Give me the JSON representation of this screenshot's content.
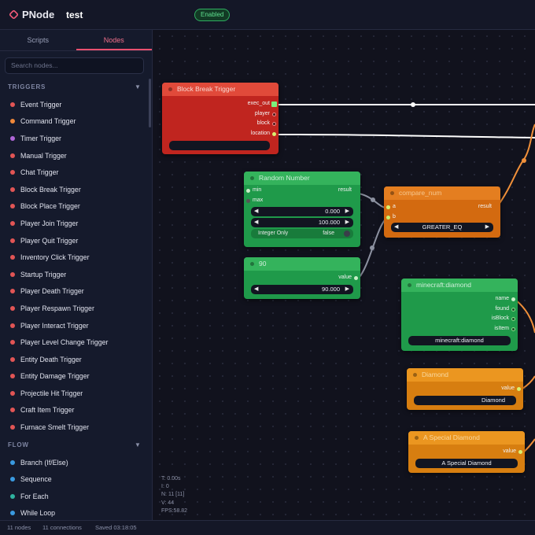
{
  "app": {
    "logo_text": "PNode",
    "project_title": "test",
    "status_badge": "Enabled"
  },
  "sidebar": {
    "tabs": [
      {
        "label": "Scripts"
      },
      {
        "label": "Nodes"
      }
    ],
    "search_placeholder": "Search nodes...",
    "categories": [
      {
        "label": "TRIGGERS",
        "chevron": "▼",
        "items": [
          {
            "label": "Event Trigger",
            "color": "#e25555"
          },
          {
            "label": "Command Trigger",
            "color": "#f0883a"
          },
          {
            "label": "Timer Trigger",
            "color": "#b066d8"
          },
          {
            "label": "Manual Trigger",
            "color": "#e25555"
          },
          {
            "label": "Chat Trigger",
            "color": "#e25555"
          },
          {
            "label": "Block Break Trigger",
            "color": "#e25555"
          },
          {
            "label": "Block Place Trigger",
            "color": "#e25555"
          },
          {
            "label": "Player Join Trigger",
            "color": "#e25555"
          },
          {
            "label": "Player Quit Trigger",
            "color": "#e25555"
          },
          {
            "label": "Inventory Click Trigger",
            "color": "#e25555"
          },
          {
            "label": "Startup Trigger",
            "color": "#e25555"
          },
          {
            "label": "Player Death Trigger",
            "color": "#e25555"
          },
          {
            "label": "Player Respawn Trigger",
            "color": "#e25555"
          },
          {
            "label": "Player Interact Trigger",
            "color": "#e25555"
          },
          {
            "label": "Player Level Change Trigger",
            "color": "#e25555"
          },
          {
            "label": "Entity Death Trigger",
            "color": "#e25555"
          },
          {
            "label": "Entity Damage Trigger",
            "color": "#e25555"
          },
          {
            "label": "Projectile Hit Trigger",
            "color": "#e25555"
          },
          {
            "label": "Craft Item Trigger",
            "color": "#e25555"
          },
          {
            "label": "Furnace Smelt Trigger",
            "color": "#e25555"
          }
        ]
      },
      {
        "label": "FLOW",
        "chevron": "▼",
        "items": [
          {
            "label": "Branch (If/Else)",
            "color": "#3a9ae0"
          },
          {
            "label": "Sequence",
            "color": "#3a9ae0"
          },
          {
            "label": "For Each",
            "color": "#2fb3a0"
          },
          {
            "label": "While Loop",
            "color": "#3a9ae0"
          }
        ]
      }
    ]
  },
  "nodes": {
    "block_break": {
      "title": "Block Break Trigger",
      "outputs": [
        "exec_out",
        "player",
        "block",
        "location"
      ],
      "field_value": ""
    },
    "random_number": {
      "title": "Random Number",
      "inputs": [
        "min",
        "max"
      ],
      "output": "result",
      "min_value": "0.000",
      "max_value": "100.000",
      "toggle_label": "Integer Only",
      "toggle_value": "false"
    },
    "number_90": {
      "title": "90",
      "output": "value",
      "value": "90.000"
    },
    "compare": {
      "title": "compare_num",
      "inputs": [
        "a",
        "b"
      ],
      "output": "result",
      "operator": "GREATER_EQ"
    },
    "mc_diamond": {
      "title": "minecraft:diamond",
      "outputs": [
        "name",
        "found",
        "isBlock",
        "isItem"
      ],
      "value": "minecraft:diamond"
    },
    "text_diamond": {
      "title": "Diamond",
      "output": "value",
      "value": "Diamond"
    },
    "text_special": {
      "title": "A Special Diamond",
      "output": "value",
      "value": "A Special Diamond"
    }
  },
  "stats": {
    "time": "T: 0.00s",
    "iterations": "I: 0",
    "nodes": "N: 11 [11]",
    "visible": "V: 44",
    "fps": "FPS:58.82"
  },
  "footer": {
    "nodes": "11 nodes",
    "connections": "11 connections",
    "saved": "Saved 03:18:05"
  },
  "colors": {
    "accent": "#e9506f",
    "trigger_node": "#c0251f",
    "value_node": "#1f9a4a",
    "logic_node": "#d36a10",
    "text_node": "#e8860f",
    "enabled": "#2fae60"
  }
}
